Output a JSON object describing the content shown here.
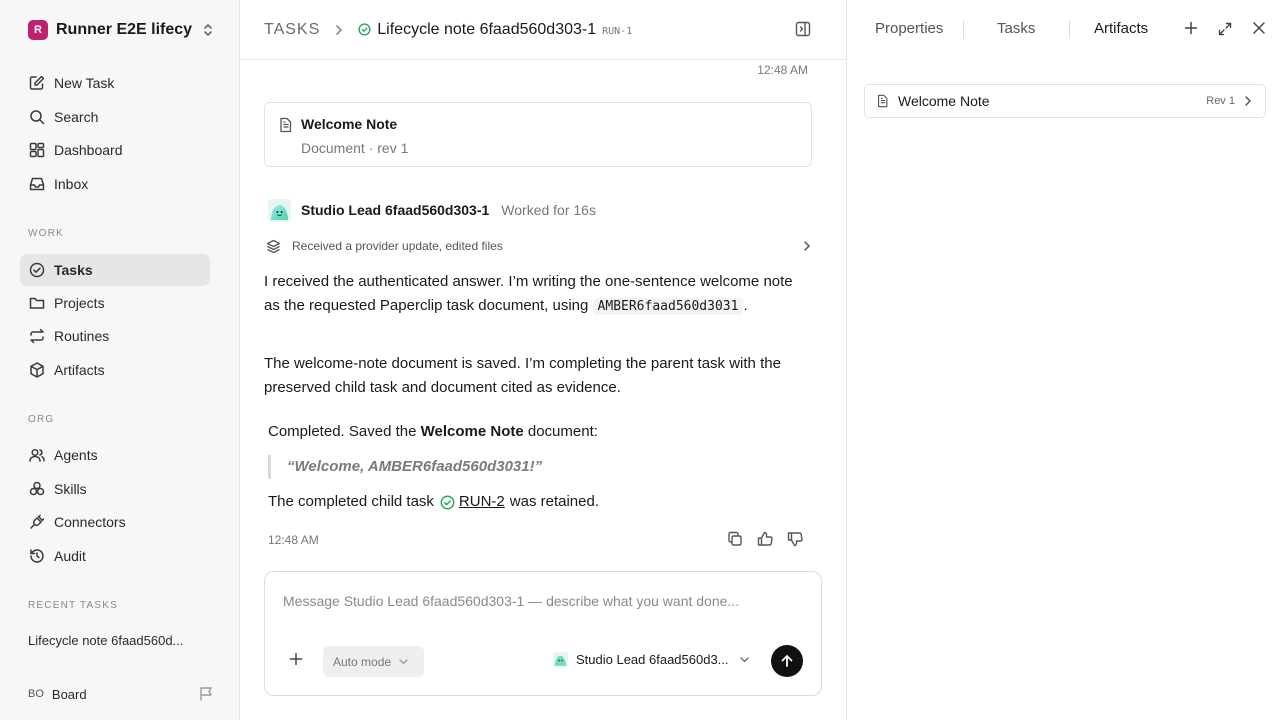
{
  "workspace": {
    "initial": "R",
    "name": "Runner E2E lifecy…",
    "color": "#c0206e"
  },
  "nav": {
    "primary": [
      {
        "label": "New Task",
        "icon": "pencil-square-icon"
      },
      {
        "label": "Search",
        "icon": "search-icon"
      },
      {
        "label": "Dashboard",
        "icon": "dashboard-icon"
      },
      {
        "label": "Inbox",
        "icon": "inbox-icon"
      }
    ],
    "work_label": "WORK",
    "work": [
      {
        "label": "Tasks",
        "icon": "check-circle-icon",
        "active": true
      },
      {
        "label": "Projects",
        "icon": "folder-icon"
      },
      {
        "label": "Routines",
        "icon": "repeat-icon"
      },
      {
        "label": "Artifacts",
        "icon": "cube-icon"
      }
    ],
    "org_label": "ORG",
    "org": [
      {
        "label": "Agents",
        "icon": "users-icon"
      },
      {
        "label": "Skills",
        "icon": "skills-icon"
      },
      {
        "label": "Connectors",
        "icon": "plug-icon"
      },
      {
        "label": "Audit",
        "icon": "history-icon"
      }
    ],
    "recent_label": "RECENT TASKS",
    "recent": [
      "Lifecycle note 6faad560d..."
    ],
    "board": {
      "initials": "BO",
      "label": "Board"
    }
  },
  "header": {
    "section": "TASKS",
    "title": "Lifecycle note 6faad560d303-1",
    "id": "RUN-1",
    "status_color": "#22a55a"
  },
  "thread": {
    "top_timestamp": "12:48 AM",
    "doc_card": {
      "title": "Welcome Note",
      "subtitle": "Document · rev 1"
    },
    "agent": {
      "name": "Studio Lead 6faad560d303-1",
      "worked": "Worked for 16s"
    },
    "activity": "Received a provider update, edited files",
    "para1": "I received the authenticated answer. I’m writing the one-sentence welcome note as the requested Paperclip task document, using",
    "para1_code": "AMBER6faad560d3031",
    "para1_end": ".",
    "para2": "The welcome-note document is saved. I’m completing the parent task with the preserved child task and document cited as evidence.",
    "completed_pre": "Completed. Saved the",
    "completed_bold": "Welcome Note",
    "completed_post": "document:",
    "quote": "“Welcome, AMBER6faad560d3031!”",
    "retained_pre": "The completed child task",
    "retained_link": "RUN-2",
    "retained_post": "was retained.",
    "bottom_timestamp": "12:48 AM"
  },
  "composer": {
    "placeholder": "Message Studio Lead 6faad560d303-1 — describe what you want done...",
    "mode": "Auto mode",
    "agent": "Studio Lead 6faad560d3..."
  },
  "right_panel": {
    "tabs": [
      "Properties",
      "Tasks",
      "Artifacts"
    ],
    "active_tab": "Artifacts",
    "artifact": {
      "title": "Welcome Note",
      "rev": "Rev 1"
    }
  }
}
